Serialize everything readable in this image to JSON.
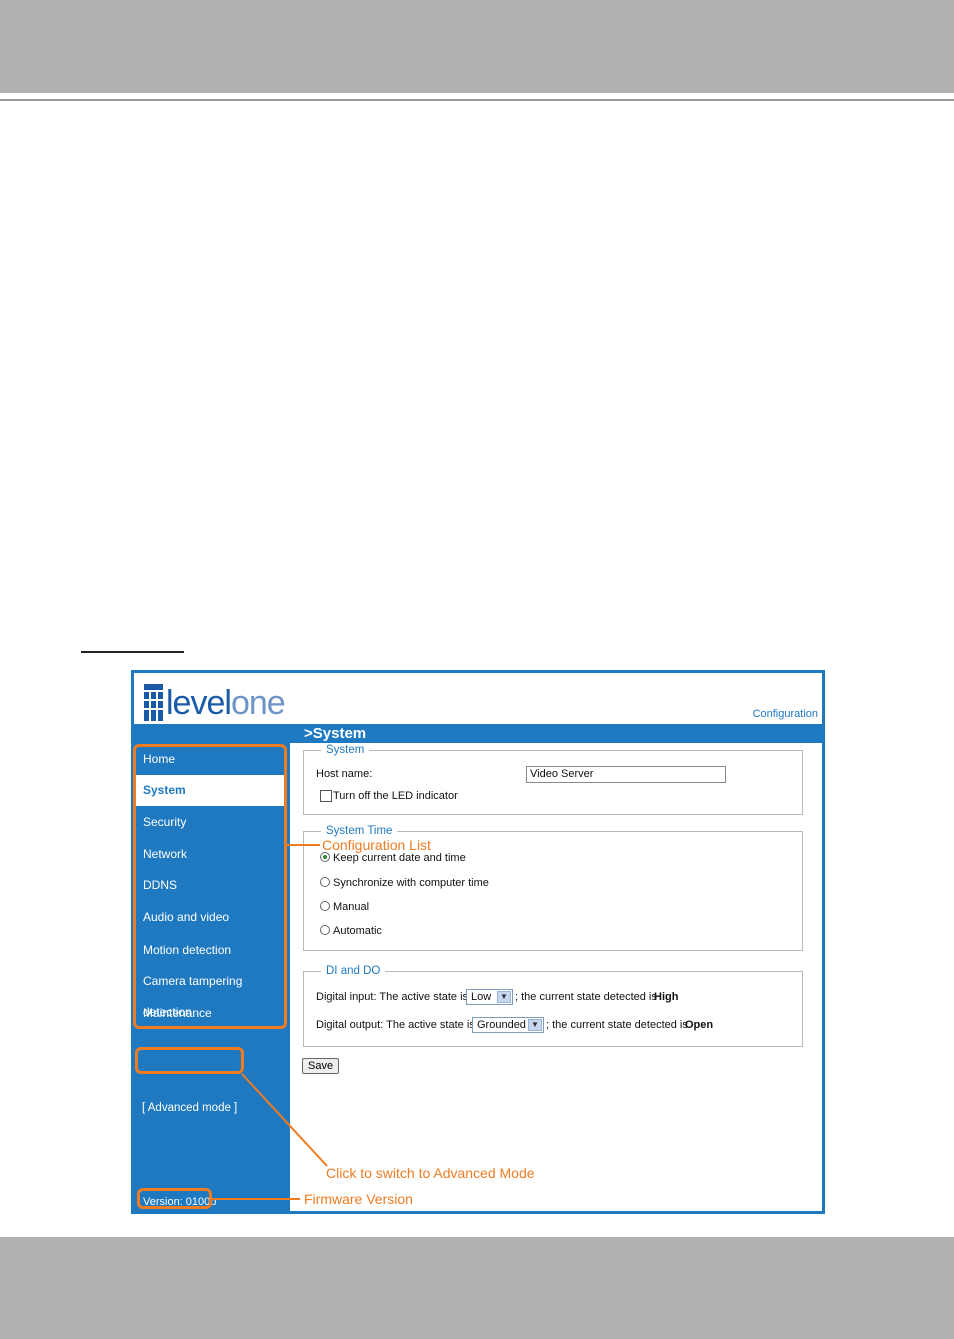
{
  "screen": {
    "logo_text_main": "level",
    "logo_text_accent": "one",
    "config_link": "Configuration",
    "page_title": ">System",
    "sidebar": {
      "items": [
        {
          "label": "Home",
          "active": false
        },
        {
          "label": "System",
          "active": true
        },
        {
          "label": "Security",
          "active": false
        },
        {
          "label": "Network",
          "active": false
        },
        {
          "label": "DDNS",
          "active": false
        },
        {
          "label": "Audio and video",
          "active": false
        },
        {
          "label": "Motion detection",
          "active": false
        },
        {
          "label": "Camera tampering detection",
          "active": false
        },
        {
          "label": "Maintenance",
          "active": false
        }
      ],
      "advanced_mode": "[ Advanced mode ]",
      "version": "Version: 0100b"
    },
    "system_group": {
      "legend": "System",
      "host_name_label": "Host name:",
      "host_name_value": "Video Server",
      "led_label": "Turn off the LED indicator",
      "led_checked": false
    },
    "time_group": {
      "legend": "System Time",
      "options": [
        {
          "label": "Keep current date and time",
          "checked": true
        },
        {
          "label": "Synchronize with computer time",
          "checked": false
        },
        {
          "label": "Manual",
          "checked": false
        },
        {
          "label": "Automatic",
          "checked": false
        }
      ]
    },
    "dido_group": {
      "legend": "DI and DO",
      "di_prefix": "Digital input: The active state is",
      "di_value": "Low",
      "di_mid": "; the current state detected is",
      "di_state": "High",
      "do_prefix": "Digital output: The active state is",
      "do_value": "Grounded",
      "do_mid": "; the current state detected is",
      "do_state": "Open"
    },
    "save_button": "Save"
  },
  "annotations": {
    "config_list": "Configuration List",
    "advanced_mode": "Click to switch to Advanced Mode",
    "firmware": "Firmware Version"
  },
  "colors": {
    "brand_blue": "#1f79c1",
    "annotation_orange": "#f07c22",
    "page_band_gray": "#b0b0b0"
  }
}
